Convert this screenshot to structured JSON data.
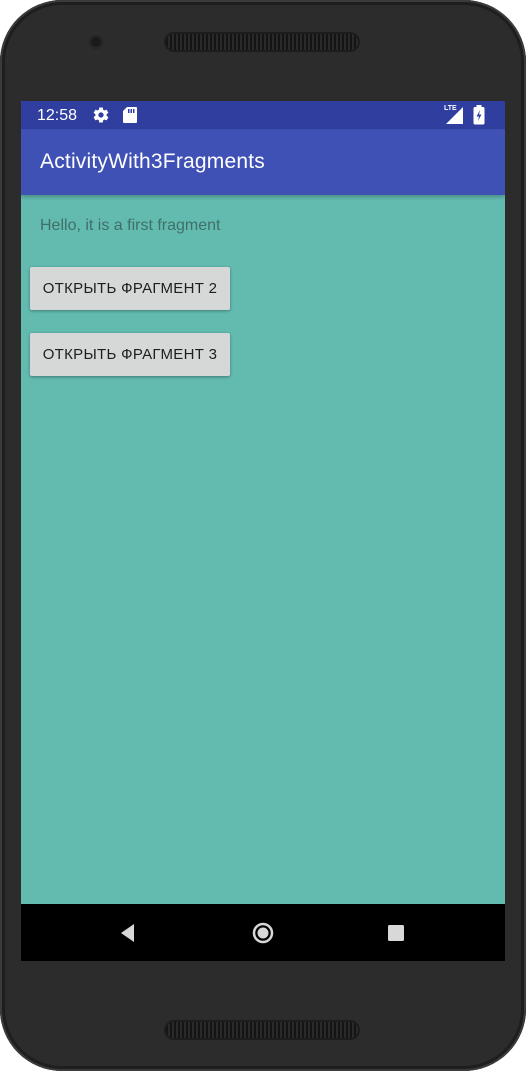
{
  "status_bar": {
    "time": "12:58",
    "network_label": "LTE",
    "icons": [
      "settings-gear-icon",
      "sd-card-icon",
      "lte-signal-icon",
      "battery-charging-icon"
    ]
  },
  "app_bar": {
    "title": "ActivityWith3Fragments"
  },
  "fragment": {
    "text": "Hello, it is a first fragment",
    "buttons": [
      {
        "label": "ОТКРЫТЬ ФРАГМЕНТ 2"
      },
      {
        "label": "ОТКРЫТЬ ФРАГМЕНТ 3"
      }
    ]
  },
  "nav_bar": {
    "icons": [
      "back-icon",
      "home-icon",
      "recents-icon"
    ]
  },
  "colors": {
    "status_bar": "#303f9f",
    "app_bar": "#3f51b5",
    "background": "#63bbb0",
    "button": "#d6d7d7",
    "nav_bar": "#000000"
  }
}
